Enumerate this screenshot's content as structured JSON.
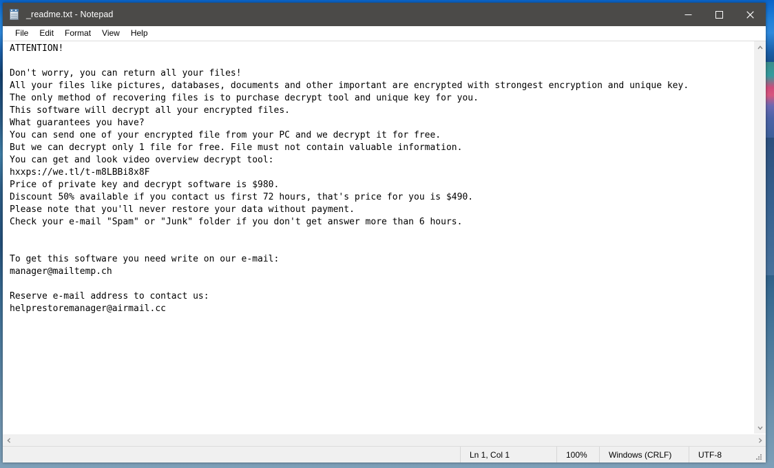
{
  "window": {
    "title": "_readme.txt - Notepad",
    "icon": "notepad-icon",
    "controls": {
      "minimize": "minimize-icon",
      "maximize": "maximize-icon",
      "close": "close-icon"
    }
  },
  "menu": {
    "items": [
      {
        "label": "File"
      },
      {
        "label": "Edit"
      },
      {
        "label": "Format"
      },
      {
        "label": "View"
      },
      {
        "label": "Help"
      }
    ]
  },
  "document": {
    "filename": "_readme.txt",
    "lines": [
      "ATTENTION!",
      "",
      "Don't worry, you can return all your files!",
      "All your files like pictures, databases, documents and other important are encrypted with strongest encryption and unique key.",
      "The only method of recovering files is to purchase decrypt tool and unique key for you.",
      "This software will decrypt all your encrypted files.",
      "What guarantees you have?",
      "You can send one of your encrypted file from your PC and we decrypt it for free.",
      "But we can decrypt only 1 file for free. File must not contain valuable information.",
      "You can get and look video overview decrypt tool:",
      "hxxps://we.tl/t-m8LBBi8x8F",
      "Price of private key and decrypt software is $980.",
      "Discount 50% available if you contact us first 72 hours, that's price for you is $490.",
      "Please note that you'll never restore your data without payment.",
      "Check your e-mail \"Spam\" or \"Junk\" folder if you don't get answer more than 6 hours.",
      "",
      "",
      "To get this software you need write on our e-mail:",
      "manager@mailtemp.ch",
      "",
      "Reserve e-mail address to contact us:",
      "helprestoremanager@airmail.cc"
    ],
    "text": "ATTENTION!\n\nDon't worry, you can return all your files!\nAll your files like pictures, databases, documents and other important are encrypted with strongest encryption and unique key.\nThe only method of recovering files is to purchase decrypt tool and unique key for you.\nThis software will decrypt all your encrypted files.\nWhat guarantees you have?\nYou can send one of your encrypted file from your PC and we decrypt it for free.\nBut we can decrypt only 1 file for free. File must not contain valuable information.\nYou can get and look video overview decrypt tool:\nhxxps://we.tl/t-m8LBBi8x8F\nPrice of private key and decrypt software is $980.\nDiscount 50% available if you contact us first 72 hours, that's price for you is $490.\nPlease note that you'll never restore your data without payment.\nCheck your e-mail \"Spam\" or \"Junk\" folder if you don't get answer more than 6 hours.\n\n\nTo get this software you need write on our e-mail:\nmanager@mailtemp.ch\n\nReserve e-mail address to contact us:\nhelprestoremanager@airmail.cc",
    "contacts": {
      "primary_email": "manager@mailtemp.ch",
      "reserve_email": "helprestoremanager@airmail.cc",
      "video_url": "hxxps://we.tl/t-m8LBBi8x8F",
      "price": "$980",
      "discounted_price": "$490",
      "discount": "50%",
      "discount_window_hours": "72",
      "answer_window_hours": "6"
    }
  },
  "scrollbars": {
    "vertical_up": "chevron-up-icon",
    "vertical_down": "chevron-down-icon",
    "horizontal_left": "chevron-left-icon",
    "horizontal_right": "chevron-right-icon"
  },
  "status": {
    "cursor": "Ln 1, Col 1",
    "zoom": "100%",
    "line_ending": "Windows (CRLF)",
    "encoding": "UTF-8"
  },
  "colors": {
    "titlebar": "#4b4a48",
    "titlebar_text": "#ffffff",
    "window_bg": "#ffffff",
    "chrome": "#f0f0f0",
    "text": "#000000",
    "desktop": "#2e5f88"
  }
}
